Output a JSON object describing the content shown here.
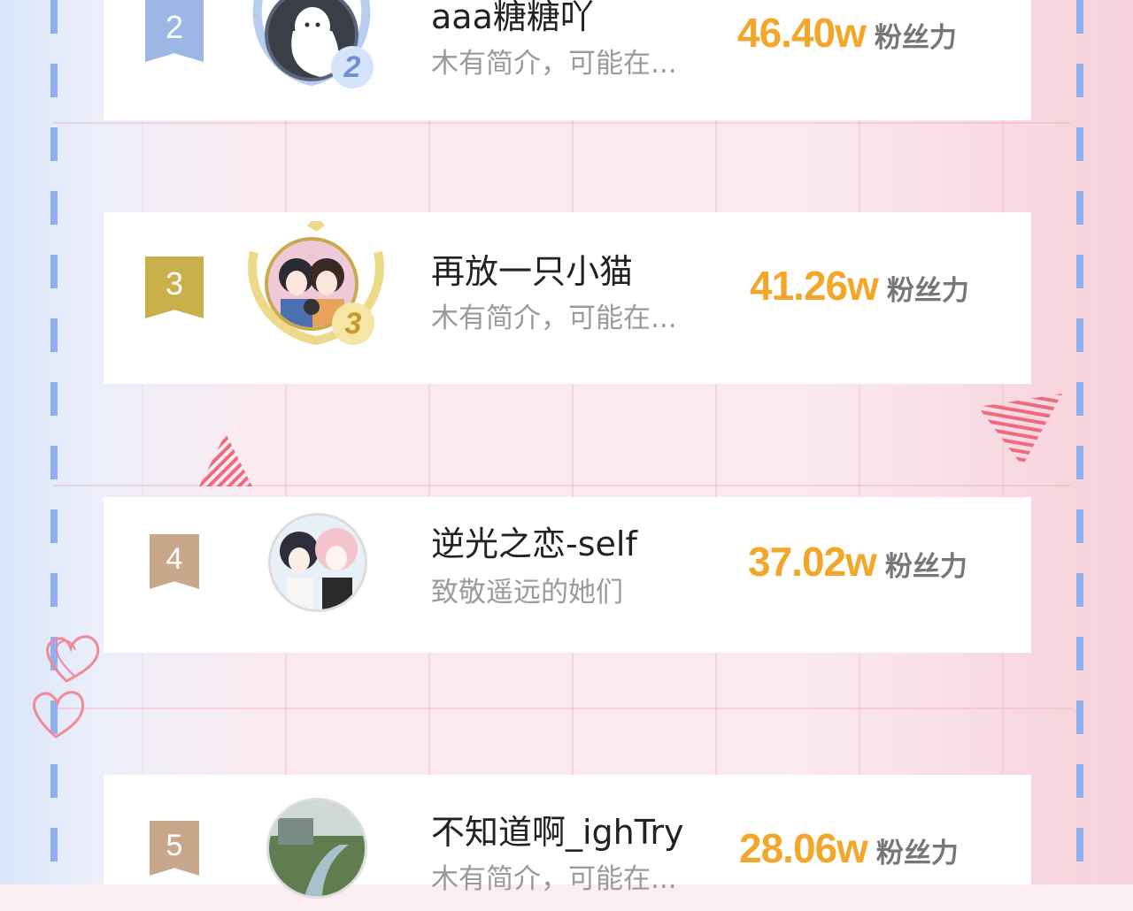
{
  "colors": {
    "score": "#f3a72a",
    "rank2": "#9cb6e6",
    "rank3": "#c9b04a",
    "rank45": "#c8a78a",
    "dash": "#8fb0ee"
  },
  "ranking": [
    {
      "rank": "2",
      "badge": "2",
      "name": "aaa糖糖吖",
      "bio": "木有简介，可能在...",
      "score": "46.40w",
      "unit": "粉丝力",
      "avatar_icon": "ghost-avatar-icon"
    },
    {
      "rank": "3",
      "badge": "3",
      "name": "再放一只小猫",
      "bio": "木有简介，可能在...",
      "score": "41.26w",
      "unit": "粉丝力",
      "avatar_icon": "couple-avatar-icon"
    },
    {
      "rank": "4",
      "badge": "",
      "name": "逆光之恋-self",
      "bio": "致敬遥远的她们",
      "score": "37.02w",
      "unit": "粉丝力",
      "avatar_icon": "anime-avatar-icon"
    },
    {
      "rank": "5",
      "badge": "",
      "name": "不知道啊_ighTry",
      "bio": "木有简介，可能在...",
      "score": "28.06w",
      "unit": "粉丝力",
      "avatar_icon": "landscape-avatar-icon"
    }
  ]
}
